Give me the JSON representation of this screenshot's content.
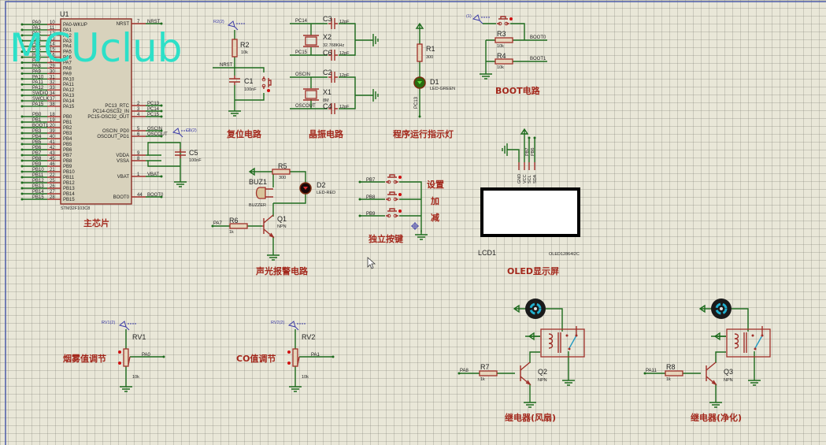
{
  "watermark": "MCUclub",
  "colors": {
    "wire": "#1d6b1d",
    "component": "#a0302a",
    "title": "#a3281c",
    "background": "#e9e7d8",
    "watermark": "#2de0c8",
    "probe": "#3b3ba8"
  },
  "mcu": {
    "ref": "U1",
    "part": "STM32F103C8",
    "title": "主芯片",
    "left_pins": [
      {
        "net": "PA0",
        "num": "10",
        "name": "PA0-WKUP"
      },
      {
        "net": "PA1",
        "num": "11",
        "name": "PA1"
      },
      {
        "net": "PA2",
        "num": "12",
        "name": "PA2"
      },
      {
        "net": "PA3",
        "num": "13",
        "name": "PA3"
      },
      {
        "net": "PA4",
        "num": "14",
        "name": "PA4"
      },
      {
        "net": "PA5",
        "num": "15",
        "name": "PA5"
      },
      {
        "net": "PA6",
        "num": "16",
        "name": "PA6"
      },
      {
        "net": "PA7",
        "num": "17",
        "name": "PA7"
      },
      {
        "net": "PA8",
        "num": "29",
        "name": "PA8"
      },
      {
        "net": "PA9",
        "num": "30",
        "name": "PA9"
      },
      {
        "net": "PA10",
        "num": "31",
        "name": "PA10"
      },
      {
        "net": "PA11",
        "num": "32",
        "name": "PA11"
      },
      {
        "net": "PA12",
        "num": "33",
        "name": "PA12"
      },
      {
        "net": "SWDIO",
        "num": "34",
        "name": "PA13"
      },
      {
        "net": "SWCLK",
        "num": "37",
        "name": "PA14"
      },
      {
        "net": "PA15",
        "num": "38",
        "name": "PA15"
      },
      {
        "net": "PB0",
        "num": "18",
        "name": "PB0"
      },
      {
        "net": "PB1",
        "num": "19",
        "name": "PB1"
      },
      {
        "net": "BOOT1",
        "num": "20",
        "name": "PB2"
      },
      {
        "net": "PB3",
        "num": "39",
        "name": "PB3"
      },
      {
        "net": "PB4",
        "num": "40",
        "name": "PB4"
      },
      {
        "net": "PB5",
        "num": "41",
        "name": "PB5"
      },
      {
        "net": "PB6",
        "num": "42",
        "name": "PB6"
      },
      {
        "net": "PB7",
        "num": "43",
        "name": "PB7"
      },
      {
        "net": "PB8",
        "num": "45",
        "name": "PB8"
      },
      {
        "net": "PB9",
        "num": "46",
        "name": "PB9"
      },
      {
        "net": "PB10",
        "num": "21",
        "name": "PB10"
      },
      {
        "net": "PB11",
        "num": "22",
        "name": "PB11"
      },
      {
        "net": "PB12",
        "num": "25",
        "name": "PB12"
      },
      {
        "net": "PB13",
        "num": "26",
        "name": "PB13"
      },
      {
        "net": "PB14",
        "num": "27",
        "name": "PB14"
      },
      {
        "net": "PB15",
        "num": "28",
        "name": "PB15"
      }
    ],
    "right_pins": [
      {
        "net": "NRST",
        "num": "7",
        "name": "NRST"
      },
      {
        "net": "PC13",
        "num": "2",
        "name": "PC13_RTC"
      },
      {
        "net": "PC14",
        "num": "3",
        "name": "PC14-OSC32_IN"
      },
      {
        "net": "PC15",
        "num": "4",
        "name": "PC15-OSC32_OUT"
      },
      {
        "net": "OSCIN",
        "num": "5",
        "name": "OSCIN_PD0"
      },
      {
        "net": "OSCOUT",
        "num": "6",
        "name": "OSCOUT_PD1"
      },
      {
        "net": "",
        "num": "9",
        "name": "VDDA"
      },
      {
        "net": "",
        "num": "8",
        "name": "VSSA"
      },
      {
        "net": "VBAT",
        "num": "1",
        "name": "VBAT"
      },
      {
        "net": "BOOT0",
        "num": "44",
        "name": "BOOT0"
      }
    ],
    "c5": {
      "ref": "C5",
      "value": "100nF",
      "probe": "C5(2)"
    }
  },
  "reset": {
    "title": "复位电路",
    "probe": "R2(2)",
    "r_ref": "R2",
    "r_val": "10k",
    "c_ref": "C1",
    "c_val": "100nF",
    "net": "NRST"
  },
  "crystal": {
    "title": "晶振电路",
    "x2_ref": "X2",
    "x2_val": "32.768KHz",
    "x1_ref": "X1",
    "x1_val": "8M",
    "c3": "C3",
    "c6": "C6",
    "c2": "C2",
    "c4": "C4",
    "cap_val": "12pF",
    "nets": [
      "PC14",
      "PC15",
      "OSCIN",
      "OSCOUT"
    ]
  },
  "led": {
    "title": "程序运行指示灯",
    "r_ref": "R1",
    "r_val": "300",
    "d_ref": "D1",
    "d_val": "LED-GREEN",
    "net": "PC13"
  },
  "boot": {
    "title": "BOOT电路",
    "probe": "(1)",
    "r3": "R3",
    "r4": "R4",
    "r_val": "10k",
    "net0": "BOOT0",
    "net1": "BOOT1"
  },
  "oled": {
    "title": "OLED显示屏",
    "ref": "LCD1",
    "part": "OLED12864I2C",
    "pins": [
      "GND",
      "VCC",
      "SCL",
      "SDA"
    ],
    "nets": [
      "PB7",
      "PB6"
    ]
  },
  "alarm": {
    "title": "声光报警电路",
    "r5": "R5",
    "r5_val": "300",
    "d2": "D2",
    "d2_val": "LED-RED",
    "buz": "BUZ1",
    "buz_val": "BUZZER",
    "q": "Q1",
    "q_val": "NPN",
    "r6": "R6",
    "r6_val": "1k",
    "net": "PA7"
  },
  "keys": {
    "title": "独立按键",
    "nets": [
      "PB7",
      "PB8",
      "PB9"
    ],
    "labels": [
      "设置",
      "加",
      "减"
    ]
  },
  "rv1": {
    "title": "烟雾值调节",
    "probe": "RV1(2)",
    "ref": "RV1",
    "val": "10k",
    "net": "PA0"
  },
  "rv2": {
    "title": "CO值调节",
    "probe": "RV2(2)",
    "ref": "RV2",
    "val": "10k",
    "net": "PA1"
  },
  "relay1": {
    "title": "继电器(风扇)",
    "net": "PA8",
    "r": "R7",
    "r_val": "1k",
    "q": "Q2",
    "q_val": "NPN"
  },
  "relay2": {
    "title": "继电器(净化)",
    "net": "PA11",
    "r": "R8",
    "r_val": "1k",
    "q": "Q3",
    "q_val": "NPN"
  }
}
